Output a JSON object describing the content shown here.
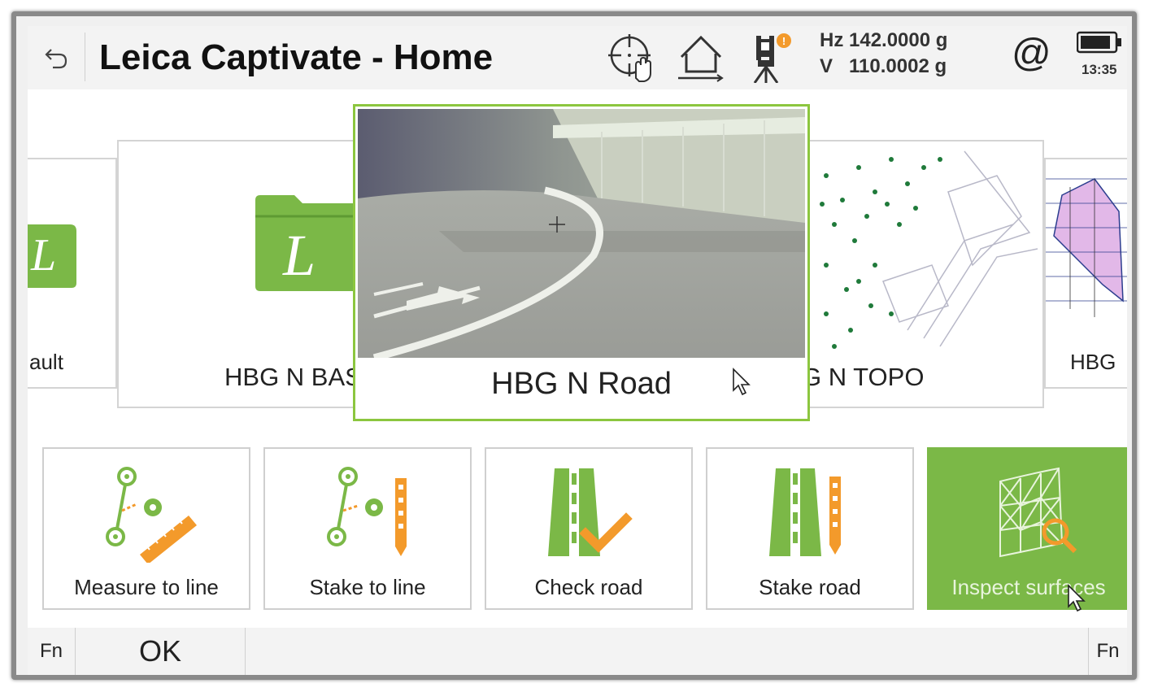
{
  "header": {
    "title": "Leica Captivate - Home",
    "hz": "Hz 142.0000 g",
    "v": "V   110.0002 g",
    "at_symbol": "@",
    "time": "13:35",
    "notification_count": "!",
    "icons": [
      "back-arrow-icon",
      "target-hand-icon",
      "home-baseline-icon",
      "instrument-icon",
      "at-icon",
      "battery-icon"
    ]
  },
  "carousel": {
    "cards": [
      {
        "label": "ault",
        "icon": "leica-folder-icon"
      },
      {
        "label": "HBG N BAS",
        "icon": "leica-folder-icon"
      },
      {
        "label": "HBG N Road",
        "icon": "road-photo",
        "selected": true
      },
      {
        "label": "G N TOPO",
        "icon": "topo-map-icon"
      },
      {
        "label": "HBG",
        "icon": "surface-map-icon"
      }
    ]
  },
  "apps": [
    {
      "label": "Measure to line",
      "icon": "measure-to-line-icon"
    },
    {
      "label": "Stake to line",
      "icon": "stake-to-line-icon"
    },
    {
      "label": "Check road",
      "icon": "check-road-icon"
    },
    {
      "label": "Stake road",
      "icon": "stake-road-icon"
    },
    {
      "label": "Inspect surfaces",
      "icon": "inspect-surfaces-icon",
      "active": true
    }
  ],
  "bottom_bar": {
    "fn_left": "Fn",
    "ok": "OK",
    "fn_right": "Fn"
  },
  "colors": {
    "leica_green": "#7bb847",
    "selection_border": "#8cc63f",
    "accent_orange": "#f39a2b"
  }
}
